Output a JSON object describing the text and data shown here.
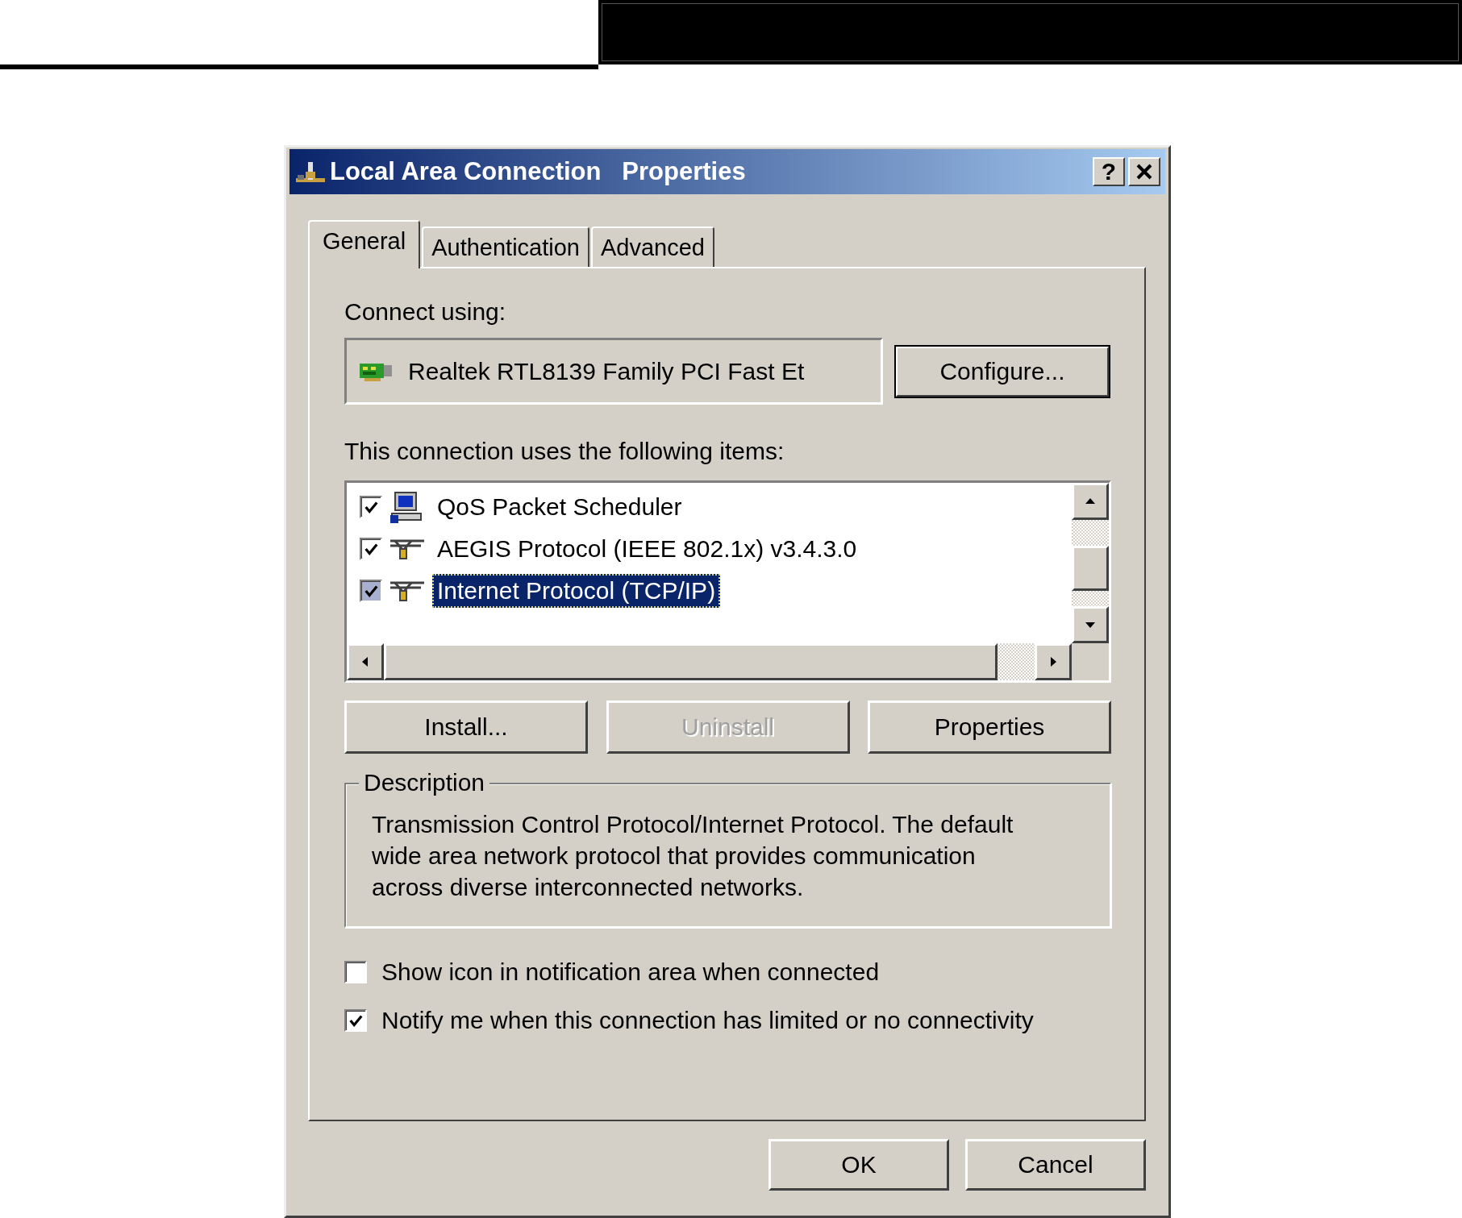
{
  "window": {
    "title": "Local Area Connection   Properties",
    "help_button": "?"
  },
  "tabs": [
    {
      "label": "General",
      "selected": true
    },
    {
      "label": "Authentication",
      "selected": false
    },
    {
      "label": "Advanced",
      "selected": false
    }
  ],
  "connect_using": {
    "label": "Connect using:",
    "adapter": "Realtek RTL8139 Family PCI Fast Et",
    "configure_button": "Configure..."
  },
  "items_label": "This connection uses the following items:",
  "items": [
    {
      "name": "QoS Packet Scheduler",
      "kind": "scheduler",
      "checked": true,
      "selected": false
    },
    {
      "name": "AEGIS Protocol (IEEE 802.1x) v3.4.3.0",
      "kind": "protocol",
      "checked": true,
      "selected": false
    },
    {
      "name": "Internet Protocol (TCP/IP)",
      "kind": "protocol",
      "checked": true,
      "selected": true
    }
  ],
  "item_buttons": [
    {
      "label": "Install...",
      "disabled": false
    },
    {
      "label": "Uninstall",
      "disabled": true
    },
    {
      "label": "Properties",
      "disabled": false
    }
  ],
  "description": {
    "title": "Description",
    "text": "Transmission Control Protocol/Internet Protocol. The default\nwide area network protocol that provides communication\nacross diverse interconnected networks."
  },
  "options": [
    {
      "label": "Show icon in notification area when connected",
      "checked": false
    },
    {
      "label": "Notify me when this connection has limited or no connectivity",
      "checked": true
    }
  ],
  "footer_buttons": [
    {
      "label": "OK"
    },
    {
      "label": "Cancel"
    }
  ]
}
